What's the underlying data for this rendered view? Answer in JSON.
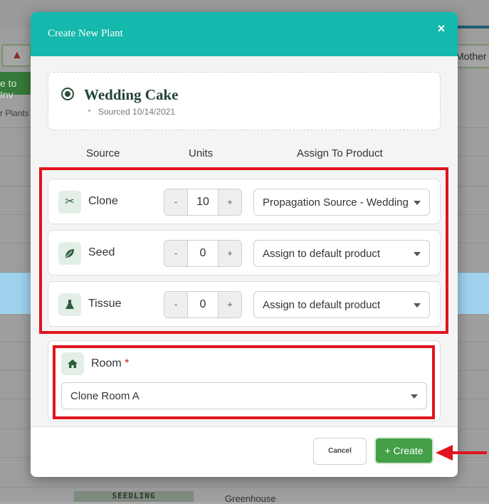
{
  "background": {
    "toolbar_button_partial": "e to Inv",
    "plants_link_partial": "r Plants",
    "mother_tag_partial": "Mother",
    "row_tag": "SEEDLING",
    "row_location": "Greenhouse",
    "alert_icon": "warning-icon"
  },
  "modal": {
    "title": "Create New Plant",
    "close_glyph": "×",
    "plant": {
      "name": "Wedding Cake",
      "sourced": "Sourced 10/14/2021"
    },
    "columns": {
      "source": "Source",
      "units": "Units",
      "assign": "Assign To Product"
    },
    "rows": [
      {
        "icon": "scissors-icon",
        "label": "Clone",
        "minus": "-",
        "units": "10",
        "plus": "+",
        "product": "Propagation Source - Wedding Cake"
      },
      {
        "icon": "leaf-icon",
        "label": "Seed",
        "minus": "-",
        "units": "0",
        "plus": "+",
        "product": "Assign to default product"
      },
      {
        "icon": "flask-icon",
        "label": "Tissue",
        "minus": "-",
        "units": "0",
        "plus": "+",
        "product": "Assign to default product"
      }
    ],
    "room": {
      "icon": "home-icon",
      "label": "Room",
      "required_mark": "*",
      "value": "Clone Room A"
    },
    "footer": {
      "cancel_label": "Cancel",
      "create_label": "+ Create"
    }
  },
  "colors": {
    "header": "#14b8ac",
    "create_button": "#43a047",
    "highlight_box": "#e0141e",
    "plant_name": "#234533"
  }
}
